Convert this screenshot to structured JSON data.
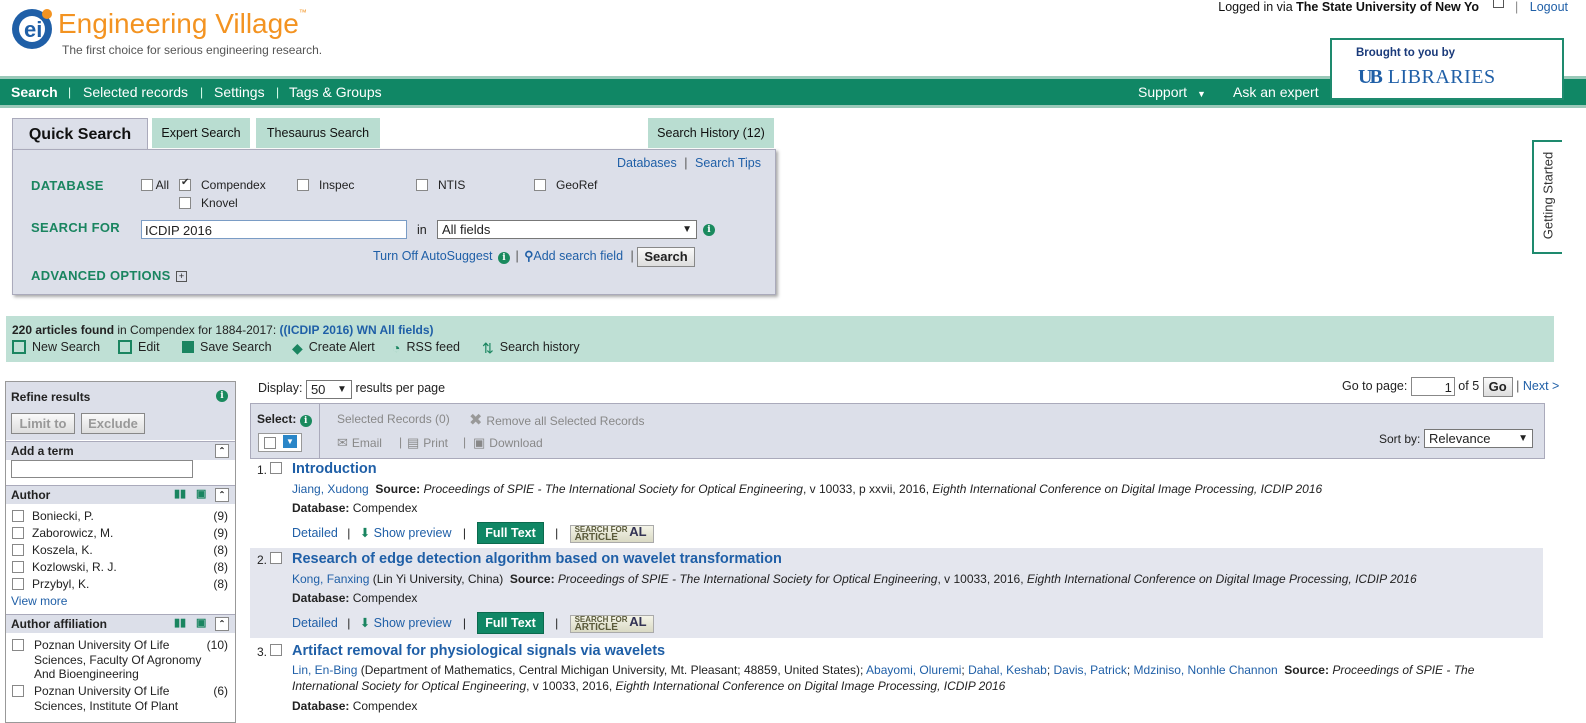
{
  "header": {
    "brand": "Engineering Village",
    "trademark": "™",
    "tagline": "The first choice for serious engineering research.",
    "logged_in_prefix": "Logged in via",
    "institution": "The State University of New Yo",
    "logout": "Logout",
    "brought_by": "Brought to you by",
    "library": "LIBRARIES",
    "library_mark": "UB"
  },
  "nav": {
    "items": [
      "Search",
      "Selected records",
      "Settings",
      "Tags & Groups"
    ],
    "right": [
      "Support",
      "Ask an expert"
    ]
  },
  "quick_search": {
    "tabs": [
      "Quick Search",
      "Expert Search",
      "Thesaurus Search"
    ],
    "history_tab": "Search History (12)",
    "links": [
      "Databases",
      "Search Tips"
    ],
    "database_label": "DATABASE",
    "databases": [
      {
        "label": "All",
        "checked": false
      },
      {
        "label": "Compendex",
        "checked": true
      },
      {
        "label": "Inspec",
        "checked": false
      },
      {
        "label": "NTIS",
        "checked": false
      },
      {
        "label": "GeoRef",
        "checked": false
      },
      {
        "label": "Knovel",
        "checked": false
      }
    ],
    "search_for_label": "SEARCH FOR",
    "search_value": "ICDIP 2016",
    "in_label": "in",
    "field_select": "All fields",
    "autosuggest": "Turn Off AutoSuggest",
    "add_field": "Add search field",
    "search_button": "Search",
    "advanced": "ADVANCED OPTIONS"
  },
  "getting_started": "Getting Started",
  "results_banner": {
    "count": "220 articles found",
    "in_text": " in Compendex for 1884-2017: ",
    "query": "((ICDIP 2016) WN All fields)",
    "actions": [
      "New Search",
      "Edit",
      "Save Search",
      "Create Alert",
      "RSS feed",
      "Search history"
    ]
  },
  "refine": {
    "title": "Refine results",
    "limit": "Limit to",
    "exclude": "Exclude",
    "add_term": "Add a term",
    "author_title": "Author",
    "authors": [
      {
        "name": "Boniecki, P.",
        "count": "(9)"
      },
      {
        "name": "Zaborowicz, M.",
        "count": "(9)"
      },
      {
        "name": "Koszela, K.",
        "count": "(8)"
      },
      {
        "name": "Kozlowski, R. J.",
        "count": "(8)"
      },
      {
        "name": "Przybyl, K.",
        "count": "(8)"
      }
    ],
    "view_more": "View more",
    "affiliation_title": "Author affiliation",
    "affiliations": [
      {
        "name": "Poznan University Of Life Sciences, Faculty Of Agronomy And Bioengineering",
        "count": "(10)"
      },
      {
        "name": "Poznan University Of Life Sciences, Institute Of Plant",
        "count": "(6)"
      }
    ]
  },
  "display": {
    "label": "Display:",
    "value": "50",
    "suffix": "results per page",
    "goto": "Go to page:",
    "page": "1",
    "of": "of 5",
    "go": "Go",
    "next": "Next >"
  },
  "toolbar": {
    "select": "Select:",
    "selected": "Selected Records (0)",
    "remove": "Remove all Selected Records",
    "email": "Email",
    "print": "Print",
    "download": "Download",
    "sort_label": "Sort by:",
    "sort_value": "Relevance"
  },
  "results": [
    {
      "num": "1.",
      "title": "Introduction",
      "authors": "Jiang, Xudong",
      "affil": "",
      "source_label": "Source:",
      "source": "Proceedings of SPIE - The International Society for Optical Engineering",
      "source_rest": ", v 10033, p xxvii, 2016, ",
      "conf": "Eighth International Conference on Digital Image Processing, ICDIP 2016",
      "db_label": "Database:",
      "db": "Compendex"
    },
    {
      "num": "2.",
      "title": "Research of edge detection algorithm based on wavelet transformation",
      "authors": "Kong, Fanxing",
      "affil": " (Lin Yi University, China)",
      "source_label": "Source:",
      "source": "Proceedings of SPIE - The International Society for Optical Engineering",
      "source_rest": ", v 10033, 2016, ",
      "conf": "Eighth International Conference on Digital Image Processing, ICDIP 2016",
      "db_label": "Database:",
      "db": "Compendex"
    },
    {
      "num": "3.",
      "title": "Artifact removal for physiological signals via wavelets",
      "authors": "Lin, En-Bing",
      "affil": " (Department of Mathematics, Central Michigan University, Mt. Pleasant; 48859, United States); ",
      "coauthors": [
        "Abayomi, Oluremi",
        "Dahal, Keshab",
        "Davis, Patrick",
        "Mdziniso, Nonhle Channon"
      ],
      "source_label": "Source:",
      "source": "Proceedings of SPIE - The International Society for Optical Engineering",
      "source_rest": ", v 10033, 2016, ",
      "conf": "Eighth International Conference on Digital Image Processing, ICDIP 2016",
      "db_label": "Database:",
      "db": "Compendex"
    }
  ],
  "result_actions": {
    "detailed": "Detailed",
    "preview": "Show preview",
    "fulltext": "Full Text",
    "sfa_top": "SEARCH FOR",
    "sfa_bottom": "ARTICLE",
    "sfa_mark": "AL"
  },
  "colors": {
    "nav_green": "#108765",
    "brand_orange": "#f39321",
    "link_blue": "#1f5fa7",
    "banner": "#bfe0d5",
    "panel": "#dcdfe9"
  }
}
